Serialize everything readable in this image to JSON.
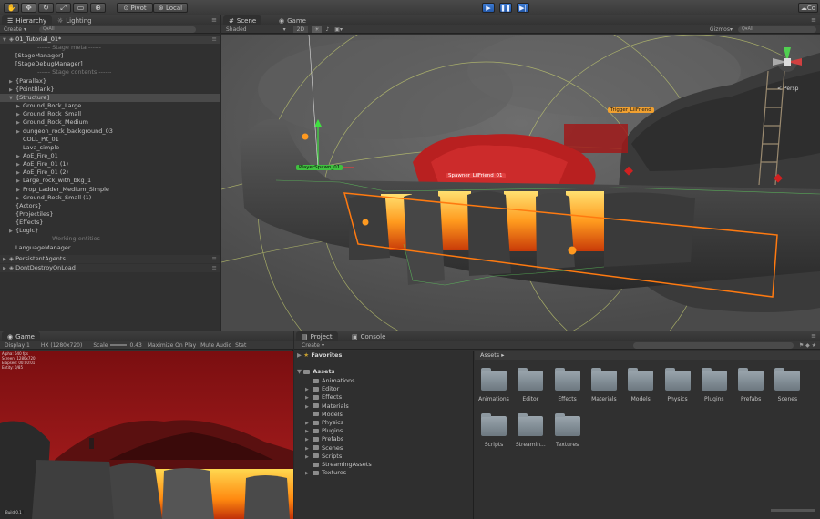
{
  "toolbar": {
    "pivot_label": "Pivot",
    "local_label": "Local",
    "tool_icons": [
      "hand-icon",
      "move-icon",
      "rotate-icon",
      "scale-icon",
      "rect-icon",
      "transform-icon"
    ],
    "play_icons": [
      "play-icon",
      "pause-icon",
      "step-icon"
    ],
    "right_label": "Co"
  },
  "hierarchy": {
    "tab_label": "Hierarchy",
    "lighting_tab": "Lighting",
    "create_label": "Create",
    "search_placeholder": "Q▾All",
    "scene_name": "01_Tutorial_01*",
    "items": [
      {
        "label": "------ Stage meta ------",
        "indent": 3,
        "type": "sep",
        "arrow": ""
      },
      {
        "label": "[StageManager]",
        "indent": 1,
        "arrow": ""
      },
      {
        "label": "[StageDebugManager]",
        "indent": 1,
        "arrow": ""
      },
      {
        "label": "------ Stage contents ------",
        "indent": 3,
        "type": "sep",
        "arrow": ""
      },
      {
        "label": "{Parallax}",
        "indent": 1,
        "arrow": "▶"
      },
      {
        "label": "{PointBlank}",
        "indent": 1,
        "arrow": "▶"
      },
      {
        "label": "{Structure}",
        "indent": 1,
        "arrow": "▼",
        "type": "sel"
      },
      {
        "label": "Ground_Rock_Large",
        "indent": 2,
        "arrow": "▶"
      },
      {
        "label": "Ground_Rock_Small",
        "indent": 2,
        "arrow": "▶"
      },
      {
        "label": "Ground_Rock_Medium",
        "indent": 2,
        "arrow": "▶"
      },
      {
        "label": "dungeon_rock_background_03",
        "indent": 2,
        "arrow": "▶"
      },
      {
        "label": "COLL_Pit_01",
        "indent": 2,
        "arrow": ""
      },
      {
        "label": "Lava_simple",
        "indent": 2,
        "arrow": ""
      },
      {
        "label": "AoE_Fire_01",
        "indent": 2,
        "arrow": "▶"
      },
      {
        "label": "AoE_Fire_01 (1)",
        "indent": 2,
        "arrow": "▶"
      },
      {
        "label": "AoE_Fire_01 (2)",
        "indent": 2,
        "arrow": "▶"
      },
      {
        "label": "Large_rock_with_bkg_1",
        "indent": 2,
        "arrow": "▶"
      },
      {
        "label": "Prop_Ladder_Medium_Simple",
        "indent": 2,
        "arrow": "▶"
      },
      {
        "label": "Ground_Rock_Small (1)",
        "indent": 2,
        "arrow": "▶"
      },
      {
        "label": "{Actors}",
        "indent": 1,
        "arrow": ""
      },
      {
        "label": "{Projectiles}",
        "indent": 1,
        "arrow": ""
      },
      {
        "label": "{Effects}",
        "indent": 1,
        "arrow": ""
      },
      {
        "label": "{Logic}",
        "indent": 1,
        "arrow": "▶"
      },
      {
        "label": "------ Working entities ------",
        "indent": 3,
        "type": "sep",
        "arrow": ""
      },
      {
        "label": "LanguageManager",
        "indent": 1,
        "arrow": ""
      }
    ],
    "persistent_agents": "PersistentAgents",
    "dont_destroy": "DontDestroyOnLoad"
  },
  "scene": {
    "tab_label": "Scene",
    "game_tab": "Game",
    "shading": "Shaded",
    "mode_2d": "2D",
    "gizmos_label": "Gizmos",
    "search_placeholder": "Q▾All",
    "persp_label": "< Persp",
    "labels": {
      "trigger": "Trigger_LilFriend",
      "spawner": "Spawner_LilFriend_01",
      "player": "PlayerSpawn_01"
    },
    "colors": {
      "trigger_label": "#f0a030",
      "spawner_label": "#e04040",
      "player_label": "#40c040"
    }
  },
  "game": {
    "tab_label": "Game",
    "display": "Display 1",
    "resolution": "HX (1280x720)",
    "scale_label": "Scale",
    "scale_value": "0.43",
    "maximize_label": "Maximize On Play",
    "mute_label": "Mute Audio",
    "stats_label": "Stat",
    "debug_lines": [
      "Alpha: 640 fps",
      "Screen: 1280x720",
      "Elapsed: 00:00:01",
      "Entity: 0/85"
    ],
    "corner_label": "Build 0.1"
  },
  "project": {
    "tab_label": "Project",
    "console_tab": "Console",
    "create_label": "Create",
    "favorites_label": "Favorites",
    "assets_label": "Assets",
    "breadcrumb": "Assets ▸",
    "tree": [
      "Animations",
      "Editor",
      "Effects",
      "Materials",
      "Models",
      "Physics",
      "Plugins",
      "Prefabs",
      "Scenes",
      "Scripts",
      "StreamingAssets",
      "Textures"
    ],
    "folders": [
      "Animations",
      "Editor",
      "Effects",
      "Materials",
      "Models",
      "Physics",
      "Plugins",
      "Prefabs",
      "Scenes",
      "Scripts",
      "Streamin...",
      "Textures"
    ]
  }
}
